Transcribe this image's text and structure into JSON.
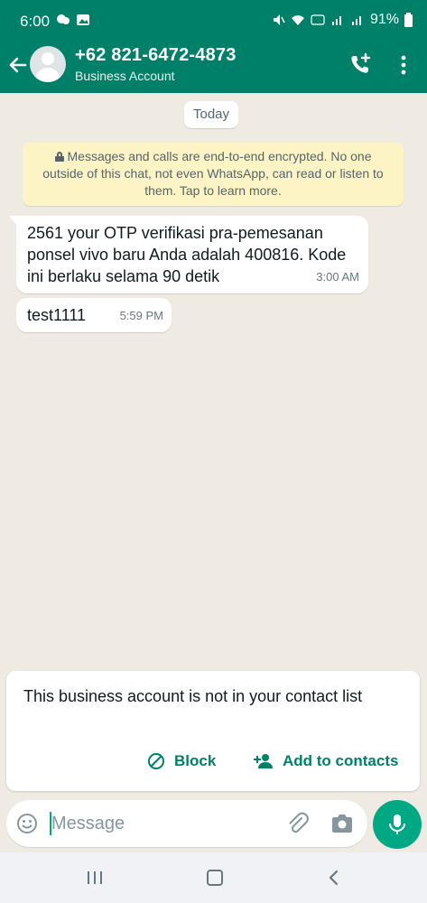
{
  "status_bar": {
    "time": "6:00",
    "battery": "91%"
  },
  "header": {
    "contact_name": "+62 821-6472-4873",
    "subtitle": "Business Account"
  },
  "chat": {
    "date_chip": "Today",
    "encryption_notice": "Messages and calls are end-to-end encrypted. No one outside of this chat, not even WhatsApp, can read or listen to them. Tap to learn more.",
    "messages": [
      {
        "text": "2561 your OTP verifikasi pra-pemesanan ponsel vivo baru Anda adalah 400816. Kode ini berlaku selama 90 detik",
        "time": "3:00 AM"
      },
      {
        "text": "test1111",
        "time": "5:59 PM"
      }
    ]
  },
  "business_card": {
    "text": "This business account is not in your contact list",
    "block_label": "Block",
    "add_label": "Add to contacts"
  },
  "composer": {
    "placeholder": "Message",
    "value": ""
  },
  "colors": {
    "header": "#008069",
    "accent": "#00a884",
    "chat_bg": "#efeae2",
    "notice_bg": "#fdf4c5"
  }
}
